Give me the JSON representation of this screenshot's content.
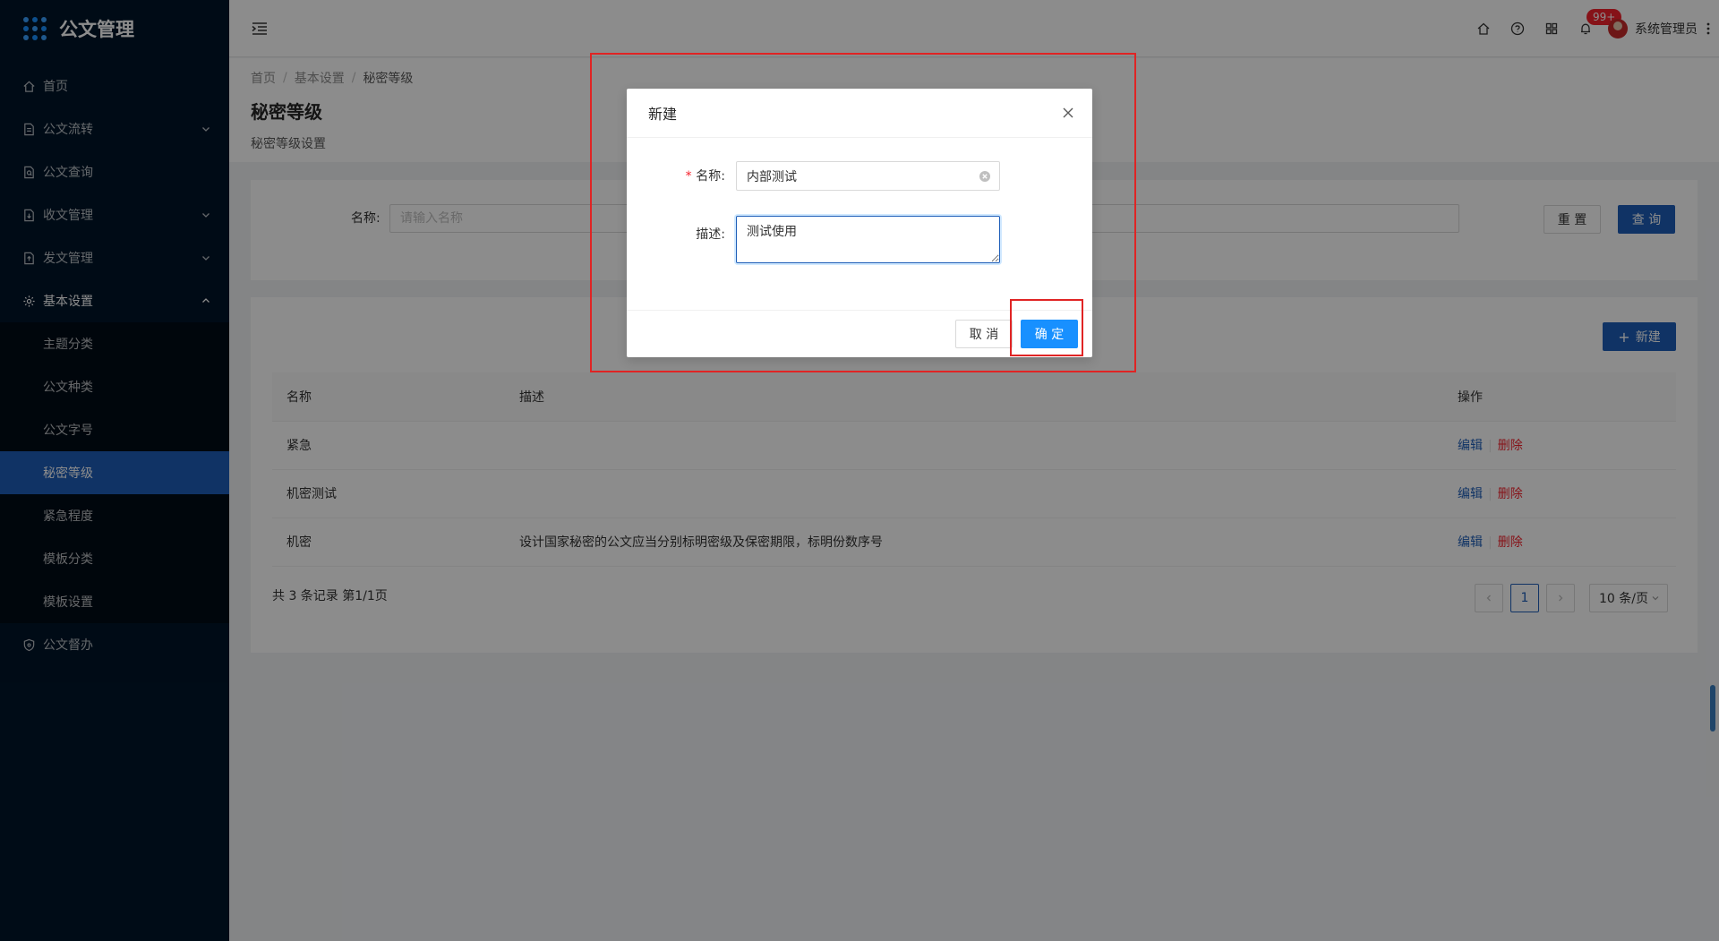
{
  "app": {
    "title": "公文管理"
  },
  "sidebar": {
    "items": [
      {
        "label": "首页"
      },
      {
        "label": "公文流转"
      },
      {
        "label": "公文查询"
      },
      {
        "label": "收文管理"
      },
      {
        "label": "发文管理"
      },
      {
        "label": "基本设置"
      },
      {
        "label": "公文督办"
      }
    ],
    "sub_items": [
      {
        "label": "主题分类"
      },
      {
        "label": "公文种类"
      },
      {
        "label": "公文字号"
      },
      {
        "label": "秘密等级"
      },
      {
        "label": "紧急程度"
      },
      {
        "label": "模板分类"
      },
      {
        "label": "模板设置"
      }
    ]
  },
  "header": {
    "badge": "99+",
    "username": "系统管理员"
  },
  "breadcrumb": [
    "首页",
    "基本设置",
    "秘密等级"
  ],
  "page": {
    "title": "秘密等级",
    "subtitle": "秘密等级设置"
  },
  "search": {
    "label": "名称:",
    "placeholder": "请输入名称",
    "reset_label": "重 置",
    "query_label": "查 询"
  },
  "table": {
    "new_label": "新建",
    "columns": [
      "名称",
      "描述",
      "操作"
    ],
    "rows": [
      {
        "name": "紧急",
        "desc": "",
        "edit": "编辑",
        "delete": "删除"
      },
      {
        "name": "机密测试",
        "desc": "",
        "edit": "编辑",
        "delete": "删除"
      },
      {
        "name": "机密",
        "desc": "设计国家秘密的公文应当分别标明密级及保密期限，标明份数序号",
        "edit": "编辑",
        "delete": "删除"
      }
    ],
    "total": "共 3 条记录 第1/1页",
    "current_page": "1",
    "page_size": "10 条/页"
  },
  "modal": {
    "title": "新建",
    "name_label": "名称:",
    "name_value": "内部测试",
    "desc_label": "描述:",
    "desc_value": "测试使用",
    "cancel_label": "取 消",
    "ok_label": "确 定"
  },
  "colors": {
    "primary": "#1e5eb8",
    "danger": "#f5222d",
    "sidebar": "#001529",
    "highlight": "#e02424"
  }
}
